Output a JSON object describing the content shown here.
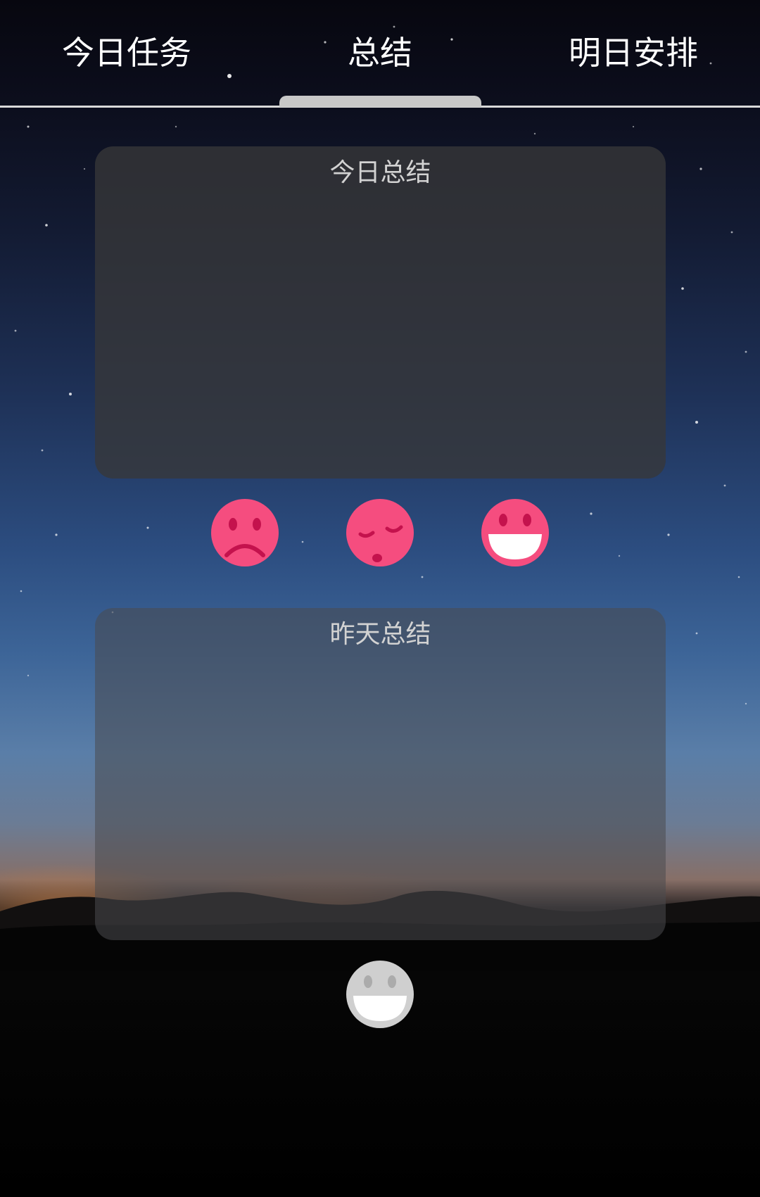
{
  "tabs": [
    {
      "label": "今日任务",
      "active": false
    },
    {
      "label": "总结",
      "active": true
    },
    {
      "label": "明日安排",
      "active": false
    }
  ],
  "today_summary": {
    "title": "今日总结",
    "value": ""
  },
  "moods": [
    {
      "name": "sad",
      "icon": "sad-face-icon",
      "color": "#f54d7f"
    },
    {
      "name": "tired",
      "icon": "sleepy-face-icon",
      "color": "#f54d7f"
    },
    {
      "name": "happy",
      "icon": "happy-face-icon",
      "color": "#f54d7f"
    }
  ],
  "yesterday_summary": {
    "title": "昨天总结",
    "value": "",
    "mood": {
      "name": "happy",
      "icon": "happy-face-icon",
      "color": "#cfcfcf"
    }
  },
  "colors": {
    "accent": "#f54d7f",
    "mood_feature": "#c4124d",
    "muted_mood": "#cfcfcf",
    "tab_text": "#ffffff",
    "card_title": "#d2d2d2"
  }
}
